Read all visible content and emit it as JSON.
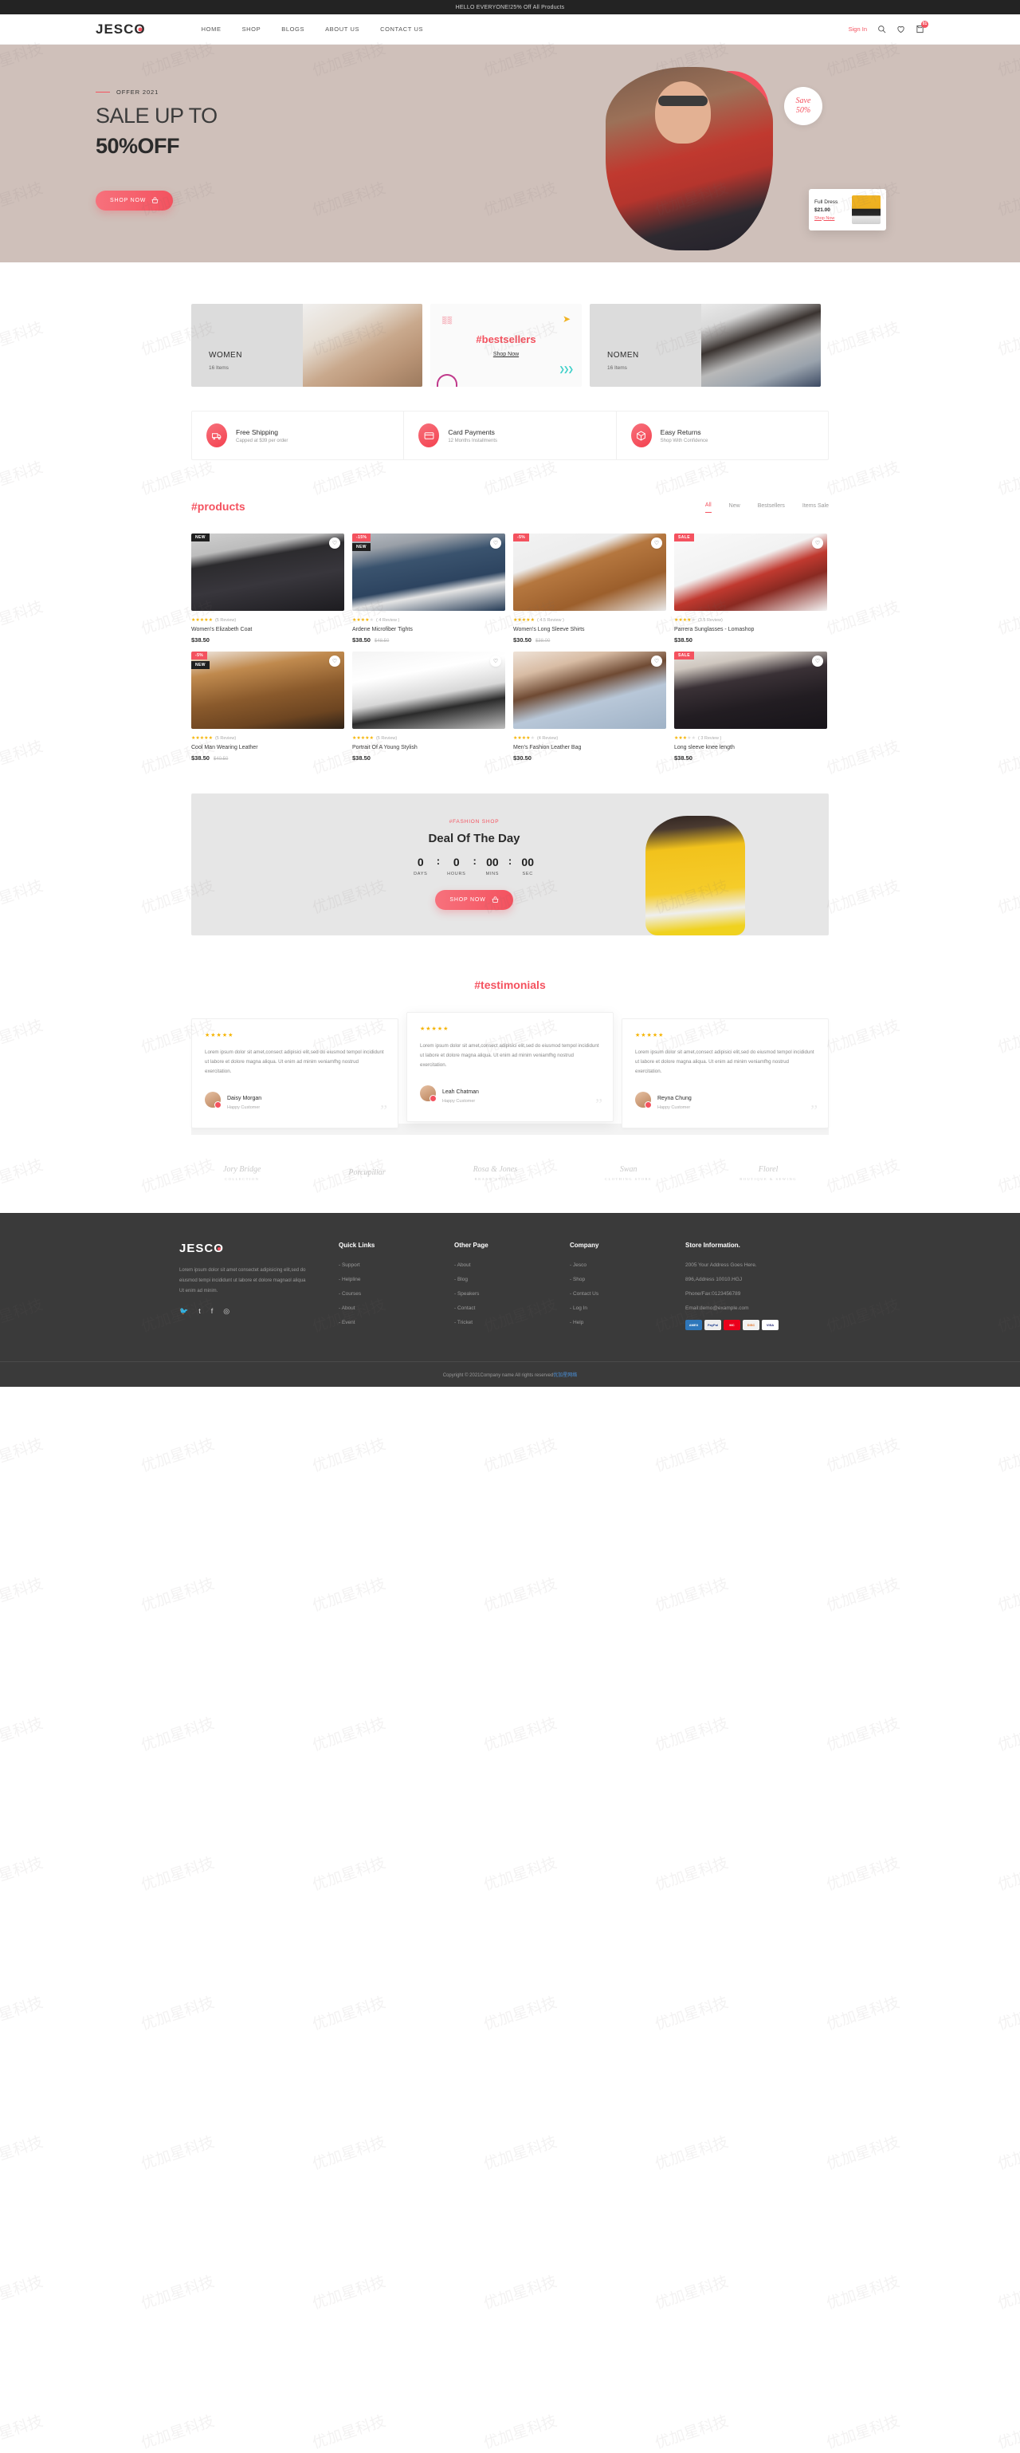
{
  "topbar": {
    "text": "HELLO EVERYONE!25% Off All Products"
  },
  "header": {
    "logo": "JESC",
    "logo_last": "O",
    "nav": [
      {
        "label": "HOME"
      },
      {
        "label": "SHOP"
      },
      {
        "label": "BLOGS"
      },
      {
        "label": "ABOUT US"
      },
      {
        "label": "CONTACT US"
      }
    ],
    "signin": "Sign In",
    "cart_count": "01",
    "icons": {
      "search": "search-icon",
      "wishlist": "heart-icon",
      "cart": "bag-icon"
    }
  },
  "hero": {
    "offer_label": "OFFER 2021",
    "heading": "SALE UP TO",
    "subheading": "50%OFF",
    "cta": "SHOP NOW",
    "save_badge_line1": "Save",
    "save_badge_line2": "50%",
    "promo": {
      "title": "Full Dress",
      "price": "$21.00",
      "link": "Shop Now"
    }
  },
  "categories": [
    {
      "label": "WOMEN",
      "count": "16 Items"
    },
    {
      "title": "#bestsellers",
      "link": "Shop Now"
    },
    {
      "label": "NOMEN",
      "count": "16 Items"
    }
  ],
  "features": [
    {
      "icon": "truck-icon",
      "title": "Free Shipping",
      "sub": "Capped at $39 per order"
    },
    {
      "icon": "credit-card-icon",
      "title": "Card Payments",
      "sub": "12 Months Installments"
    },
    {
      "icon": "package-return-icon",
      "title": "Easy Returns",
      "sub": "Shop With Confidence"
    }
  ],
  "products_section": {
    "title": "#products",
    "tabs": [
      {
        "label": "All",
        "active": true
      },
      {
        "label": "New",
        "active": false
      },
      {
        "label": "Bestsellers",
        "active": false
      },
      {
        "label": "Items Sale",
        "active": false
      }
    ],
    "items": [
      {
        "tag": "NEW",
        "tag_type": "new",
        "tag2": "",
        "stars": 5,
        "reviews": "(5 Review)",
        "name": "Women's Elizabeth Coat",
        "price": "$38.50",
        "old_price": ""
      },
      {
        "tag": "-15%",
        "tag_type": "off",
        "tag2": "NEW",
        "stars": 4,
        "reviews": "( 4 Review )",
        "name": "Ardene Microfiber Tights",
        "price": "$38.50",
        "old_price": "$48.50"
      },
      {
        "tag": "-5%",
        "tag_type": "off",
        "tag2": "",
        "stars": 4.5,
        "reviews": "( 4.5 Review )",
        "name": "Women's Long Sleeve Shirts",
        "price": "$30.50",
        "old_price": "$38.00"
      },
      {
        "tag": "SALE",
        "tag_type": "sale",
        "tag2": "",
        "stars": 3.5,
        "reviews": "(3.5 Review)",
        "name": "Parrera Sunglasses - Lomashop",
        "price": "$38.50",
        "old_price": ""
      },
      {
        "tag": "-5%",
        "tag_type": "off",
        "tag2": "NEW",
        "stars": 5,
        "reviews": "(5 Review)",
        "name": "Cool Man Wearing Leather",
        "price": "$38.50",
        "old_price": "$40.50"
      },
      {
        "tag": "",
        "tag_type": "",
        "tag2": "",
        "stars": 5,
        "reviews": "(5 Review)",
        "name": "Portrait Of A Young Stylish",
        "price": "$38.50",
        "old_price": ""
      },
      {
        "tag": "",
        "tag_type": "",
        "tag2": "",
        "stars": 4,
        "reviews": "(4 Review)",
        "name": "Men's Fashion Leather Bag",
        "price": "$30.50",
        "old_price": ""
      },
      {
        "tag": "SALE",
        "tag_type": "sale",
        "tag2": "",
        "stars": 3,
        "reviews": "( 3 Review )",
        "name": "Long sleeve knee length",
        "price": "$38.50",
        "old_price": ""
      }
    ]
  },
  "deal": {
    "kicker": "#FASHION SHOP",
    "title": "Deal Of The Day",
    "countdown": [
      {
        "value": "0",
        "label": "DAYS"
      },
      {
        "value": "0",
        "label": "HOURS"
      },
      {
        "value": "00",
        "label": "MINS"
      },
      {
        "value": "00",
        "label": "SEC"
      }
    ],
    "separator": ":",
    "cta": "SHOP NOW"
  },
  "testimonials": {
    "title": "#testimonials",
    "items": [
      {
        "stars": "★★★★★",
        "text": "Lorem ipsum dolor sit amet,consect adipisici elit,sed do eiusmod tempol incididunt ut labore et dolore magna aliqua. Ut enim ad minim veniamfhg nostrud exercitation.",
        "name": "Daisy Morgan",
        "role": "Happy Customer"
      },
      {
        "stars": "★★★★★",
        "text": "Lorem ipsum dolor sit amet,consect adipisici elit,sed do eiusmod tempol incididunt ut labore et dolore magna aliqua. Ut enim ad minim veniamfhg nostrud exercitation.",
        "name": "Leah Chatman",
        "role": "Happy Customer"
      },
      {
        "stars": "★★★★★",
        "text": "Lorem ipsum dolor sit amet,consect adipisici elit,sed do eiusmod tempol incididunt ut labore et dolore magna aliqua. Ut enim ad minim veniamfhg nostrud exercitation.",
        "name": "Reyna Chung",
        "role": "Happy Customer"
      }
    ]
  },
  "brands": [
    {
      "name": "Jory Bridge",
      "sub": "COLLECTION"
    },
    {
      "name": "Porcupillar",
      "sub": ""
    },
    {
      "name": "Rosa & Jones",
      "sub": "BRAND STUDIO"
    },
    {
      "name": "Swan",
      "sub": "CLOTHING STORE"
    },
    {
      "name": "Florel",
      "sub": "BOUTIQUE & SEWING"
    }
  ],
  "footer": {
    "logo": "JESC",
    "logo_last": "O",
    "desc": "Lorem ipsum dolor sit amet consectet adipisicing elit,sed do eiusmod tempi incididunt ut labore et dolore magnaol aliqua Ut enim ad minim.",
    "social": [
      "twitter-icon",
      "tumblr-icon",
      "facebook-icon",
      "instagram-icon"
    ],
    "columns": [
      {
        "head": "Quick Links",
        "links": [
          "- Support",
          "- Helpline",
          "- Courses",
          "- About",
          "- Event"
        ]
      },
      {
        "head": "Other Page",
        "links": [
          "- About",
          "- Blog",
          "- Speakers",
          "- Contact",
          "- Tricket"
        ]
      },
      {
        "head": "Company",
        "links": [
          "- Jesco",
          "- Shop",
          "- Contact Us",
          "- Log In",
          "- Help"
        ]
      }
    ],
    "store": {
      "head": "Store Information.",
      "lines": [
        "2005 Your Address Goes Here.",
        "896,Address 10010.HGJ",
        "Phone/Fax:0123456789",
        "Email:demo@example.com"
      ],
      "cards": [
        "AMEX",
        "PayPal",
        "MC",
        "DISC",
        "VISA"
      ]
    },
    "copyright_pre": "Copyright © 2021Company name All rights reserved",
    "copyright_link": "优加星网络"
  },
  "colors": {
    "accent": "#f4525f",
    "hero_bg": "#cfc0ba",
    "footer_bg": "#3a3a3a",
    "dark": "#232323",
    "star": "#f5b301"
  }
}
